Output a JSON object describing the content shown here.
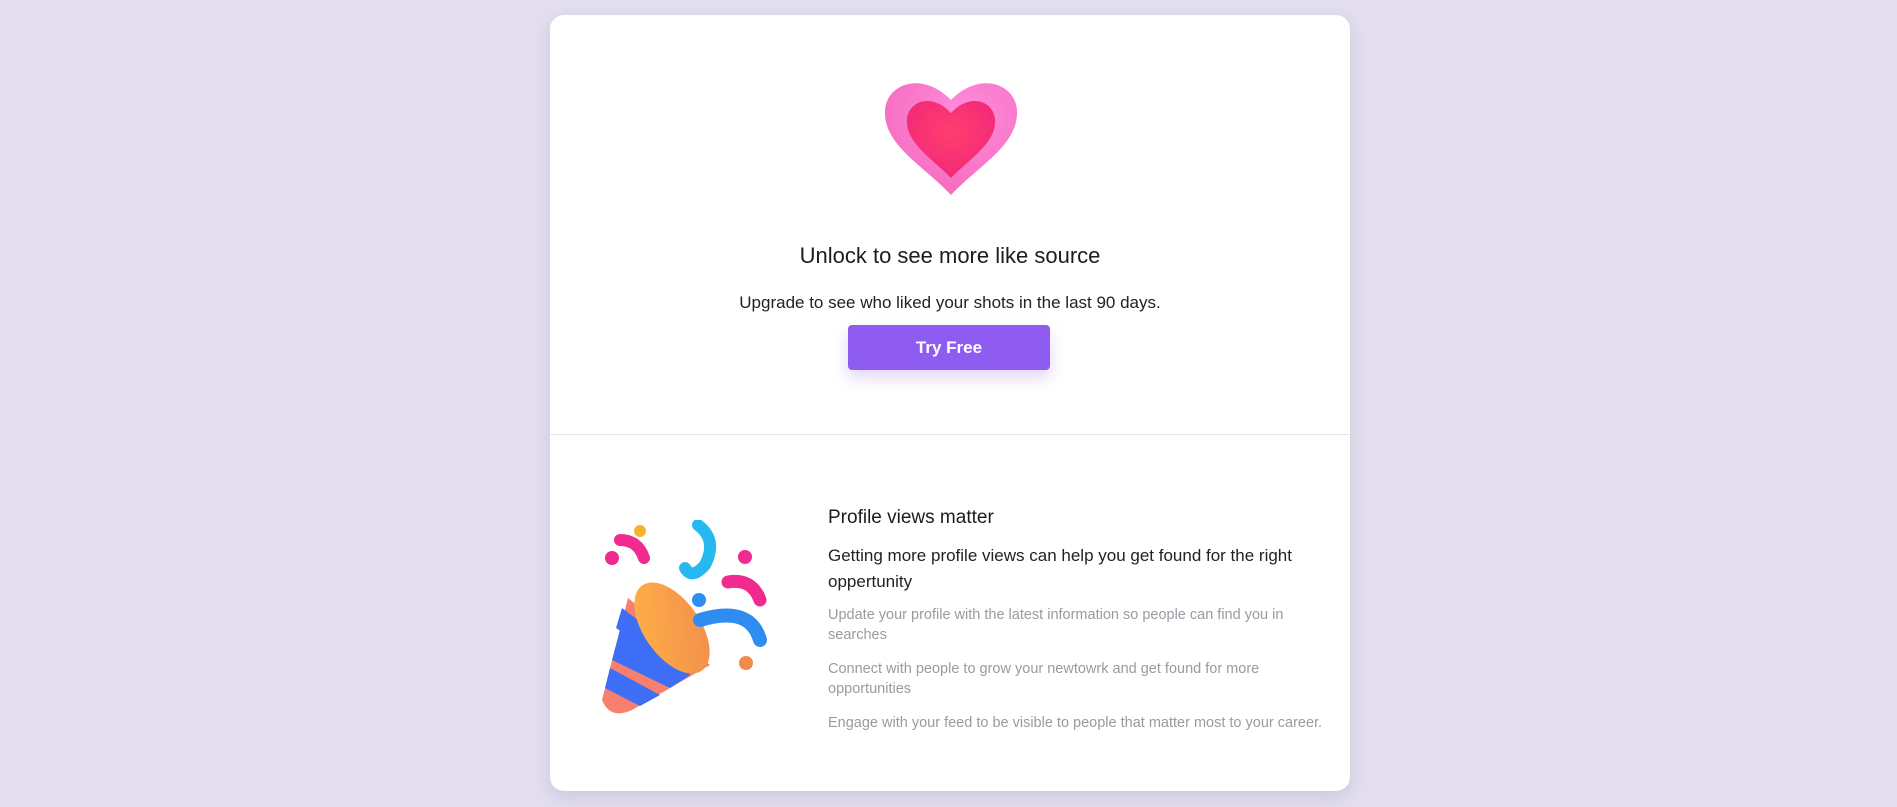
{
  "upsell": {
    "icon": "heart-icon",
    "title": "Unlock to see more like source",
    "subtitle": "Upgrade to see who liked your shots in the last 90 days.",
    "button_label": "Try Free",
    "accent": "#8f5cf2"
  },
  "tips": {
    "icon": "party-popper-icon",
    "heading": "Profile views matter",
    "lead": "Getting more profile views can help you get found for the right oppertunity",
    "items": [
      "Update your profile with the latest information so people can find you in searches",
      "Connect with people to grow your newtowrk and get found for more opportunities",
      "Engage with your feed to be visible to people that matter most to your career."
    ]
  }
}
